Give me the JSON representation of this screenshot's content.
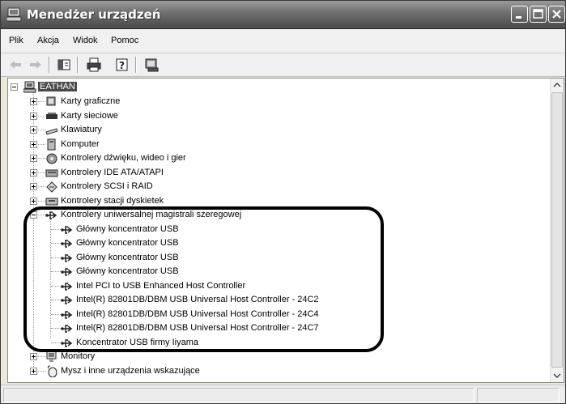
{
  "window": {
    "title": "Menedżer urządzeń",
    "icon": "device-manager-icon"
  },
  "window_controls": {
    "minimize": "minimize-icon",
    "maximize": "maximize-icon",
    "close": "close-icon"
  },
  "menu": {
    "items": [
      "Plik",
      "Akcja",
      "Widok",
      "Pomoc"
    ]
  },
  "toolbar": {
    "buttons": [
      "back-icon",
      "forward-icon",
      "properties-icon",
      "print-icon",
      "help-icon",
      "scan-hardware-icon"
    ]
  },
  "tree": {
    "root": {
      "label": "EATHAN",
      "icon": "computer-icon",
      "expanded": true
    },
    "categories": [
      {
        "label": "Karty graficzne",
        "icon": "display-adapter-icon",
        "expanded": false
      },
      {
        "label": "Karty sieciowe",
        "icon": "network-card-icon",
        "expanded": false
      },
      {
        "label": "Klawiatury",
        "icon": "keyboard-icon",
        "expanded": false
      },
      {
        "label": "Komputer",
        "icon": "computer-icon",
        "expanded": false
      },
      {
        "label": "Kontrolery dźwięku, wideo i gier",
        "icon": "sound-icon",
        "expanded": false
      },
      {
        "label": "Kontrolery IDE ATA/ATAPI",
        "icon": "ide-controller-icon",
        "expanded": false
      },
      {
        "label": "Kontrolery SCSI i RAID",
        "icon": "scsi-controller-icon",
        "expanded": false
      },
      {
        "label": "Kontrolery stacji dyskietek",
        "icon": "floppy-controller-icon",
        "expanded": false
      },
      {
        "label": "Kontrolery uniwersalnej magistrali szeregowej",
        "icon": "usb-icon",
        "expanded": true,
        "children": [
          "Główny koncentrator USB",
          "Główny koncentrator USB",
          "Główny koncentrator USB",
          "Główny koncentrator USB",
          "Intel PCI to USB Enhanced Host Controller",
          "Intel(R) 82801DB/DBM USB Universal Host Controller - 24C2",
          "Intel(R) 82801DB/DBM USB Universal Host Controller - 24C4",
          "Intel(R) 82801DB/DBM USB Universal Host Controller - 24C7",
          "Koncentrator USB firmy Iiyama"
        ]
      },
      {
        "label": "Monitory",
        "icon": "monitor-icon",
        "expanded": false
      },
      {
        "label": "Mysz i inne urządzenia wskazujące",
        "icon": "mouse-icon",
        "expanded": false
      }
    ]
  },
  "annotation": {
    "shape": "rounded-rectangle",
    "color": "#000000"
  },
  "colors": {
    "titlebar": "#6e6e6e",
    "selection": "#4a4a4a",
    "window_bg": "#ece9d8"
  }
}
